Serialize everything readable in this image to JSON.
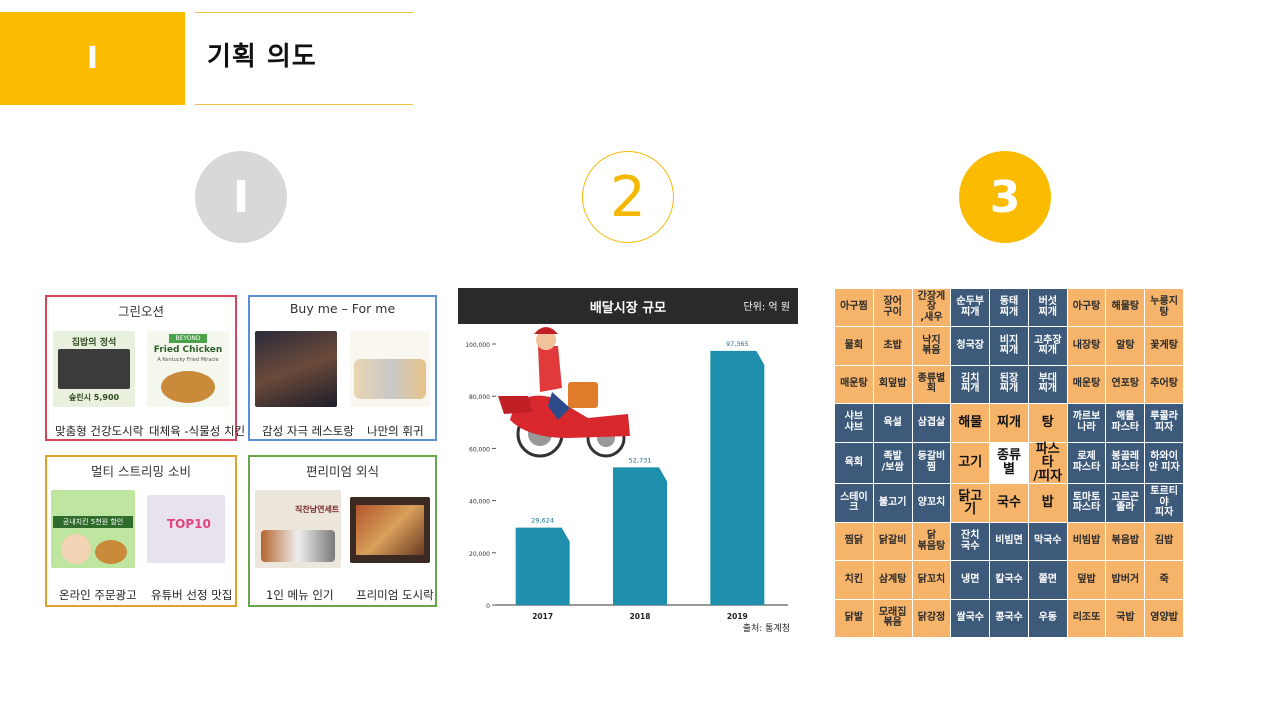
{
  "header": {
    "section_number": "I",
    "title": "기획 의도"
  },
  "circles": [
    "I",
    "2",
    "3"
  ],
  "panel1": {
    "boxes": [
      {
        "title": "그린오션",
        "captions": [
          "맞춤형 건강도시락",
          "대체육 -식물성 치킨"
        ],
        "border": "#d6455a"
      },
      {
        "title": "Buy me – For me",
        "captions": [
          "감성 자극 레스토랑",
          "나만의 휘귀"
        ],
        "border": "#5a8fd6"
      },
      {
        "title": "멀티 스트리밍 소비",
        "captions": [
          "온라인 주문광고",
          "유튜버 선정 맛집"
        ],
        "border": "#e3a02b"
      },
      {
        "title": "편리미엄 외식",
        "captions": [
          "1인 메뉴 인기",
          "프리미엄 도시락"
        ],
        "border": "#6aa54b"
      }
    ],
    "image_texts": {
      "lunch_title": "집밥의 정석",
      "lunch_price": "숲린시 5,900",
      "beyond_brand": "BEYOND",
      "beyond_product": "Fried Chicken",
      "beyond_tagline": "A Kentucky Fried Miracle",
      "ad_text": "공내치킨 5천원 할인",
      "top10": "TOP10",
      "meal_text": "직찬남연세트"
    }
  },
  "chart_data": {
    "type": "bar",
    "title": "배달시장 규모",
    "unit": "단위: 억 원",
    "source": "출처: 통계청",
    "categories": [
      "2017",
      "2018",
      "2019"
    ],
    "values": [
      29624,
      52731,
      97365
    ],
    "value_labels": [
      "29,624",
      "52,731",
      "97,365"
    ],
    "ylim": [
      0,
      100000
    ],
    "yticks": [
      0,
      20000,
      40000,
      60000,
      80000,
      100000
    ],
    "ytick_labels": [
      "0",
      "20,000",
      "40,000",
      "60,000",
      "80,000",
      "100,000"
    ],
    "bar_color": "#1f8fae"
  },
  "grid": {
    "cells": [
      [
        "아구찜",
        "장어\n구이",
        "간장게장\n,새우",
        "순두부\n찌개",
        "동태\n찌개",
        "버섯\n찌개",
        "아구탕",
        "해물탕",
        "누룽지\n탕"
      ],
      [
        "물회",
        "초밥",
        "낙지\n볶음",
        "청국장",
        "비지\n찌개",
        "고추장\n찌개",
        "내장탕",
        "알탕",
        "꽃게탕"
      ],
      [
        "매운탕",
        "회덮밥",
        "종류별\n회",
        "김치\n찌개",
        "된장\n찌개",
        "부대\n찌개",
        "매운탕",
        "연포탕",
        "추어탕"
      ],
      [
        "샤브\n샤브",
        "육설",
        "삼겹살",
        "해물",
        "찌개",
        "탕",
        "까르보\n나라",
        "해물\n파스타",
        "루콜라\n피자"
      ],
      [
        "육회",
        "족발\n/보쌈",
        "등갈비\n찜",
        "고기",
        "종류별",
        "파스타\n/피자",
        "로제\n파스타",
        "봉골레\n파스타",
        "하와이\n안 피자"
      ],
      [
        "스테이크",
        "불고기",
        "양꼬치",
        "닭고기",
        "국수",
        "밥",
        "토마토\n파스타",
        "고르곤\n졸라",
        "토르티야\n피자"
      ],
      [
        "찜닭",
        "닭갈비",
        "닭\n볶음탕",
        "잔치\n국수",
        "비빔면",
        "막국수",
        "비빔밥",
        "볶음밥",
        "김밥"
      ],
      [
        "치킨",
        "삼계탕",
        "닭꼬치",
        "냉면",
        "칼국수",
        "쫄면",
        "덮밥",
        "밥버거",
        "죽"
      ],
      [
        "닭발",
        "모래집\n볶음",
        "닭강정",
        "쌀국수",
        "콩국수",
        "우동",
        "리조또",
        "국밥",
        "영양밥"
      ]
    ],
    "colors": {
      "orange": "#f6b36a",
      "blue": "#3d5a7b"
    }
  }
}
